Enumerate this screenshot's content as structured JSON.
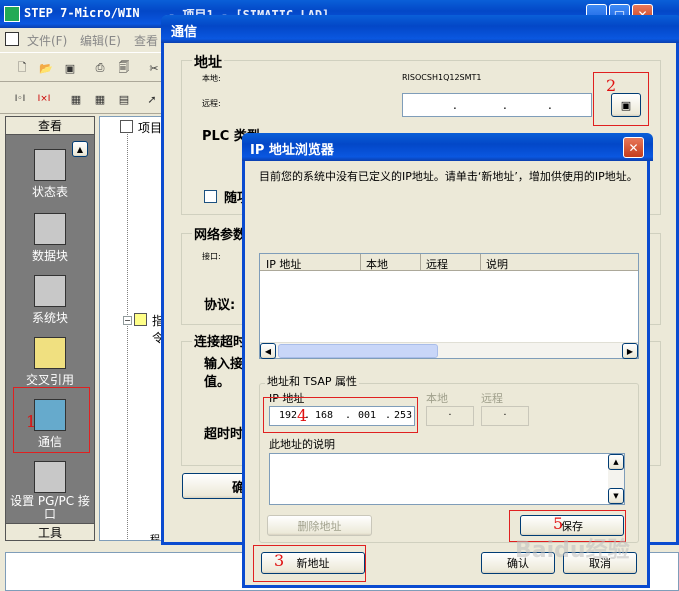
{
  "main_window": {
    "title": "STEP 7-Micro/WIN",
    "title_tail": "- 项目1 - [SIMATIC LAD]",
    "menu": [
      "文件(F)",
      "编辑(E)",
      "查看"
    ]
  },
  "nav": {
    "header": "查看",
    "items": [
      "状态表",
      "数据块",
      "系统块",
      "交叉引用",
      "通信",
      "设置 PG/PC 接口"
    ],
    "footer": "工具"
  },
  "tree": {
    "project": "项目",
    "instructions": "指令",
    "bottom": "程序块"
  },
  "comm_dialog": {
    "title": "通信",
    "address_group": "地址",
    "local_label": "本地:",
    "local_value": "RISOCSH1Q12SMT1",
    "remote_label": "远程:",
    "ip_dots": [
      ".",
      ".",
      "."
    ],
    "plc_type_label": "PLC 类型",
    "random_label": "随项",
    "network_group": "网络参数",
    "if_label": "接口:",
    "protocol_label": "协议:",
    "timeout_group": "连接超时",
    "input_label": "输入接",
    "value_label": "值。",
    "timeout_label": "超时时",
    "ok_button": "确"
  },
  "ip_dialog": {
    "title": "IP 地址浏览器",
    "description": "目前您的系统中没有已定义的IP地址。请单击‘新地址’，增加供使用的IP地址。",
    "columns": [
      "IP 地址",
      "本地",
      "远程",
      "说明"
    ],
    "tsap_group": "地址和 TSAP 属性",
    "ip_label": "IP 地址",
    "local_label": "本地",
    "remote_label": "远程",
    "ip_octets": [
      "192",
      "168",
      "001",
      "253"
    ],
    "desc_label": "此地址的说明",
    "delete_button": "删除地址",
    "save_button": "保存",
    "new_button": "新地址",
    "ok_button": "确认",
    "cancel_button": "取消"
  },
  "annotations": [
    "1",
    "2",
    "3",
    "4",
    "5"
  ],
  "watermark": "Baidu经验"
}
